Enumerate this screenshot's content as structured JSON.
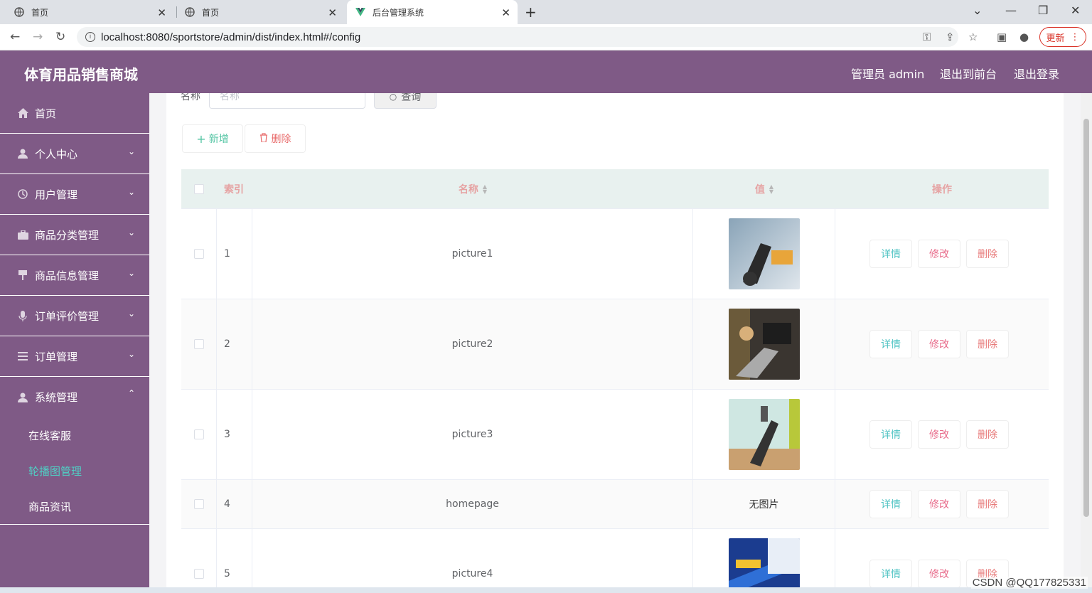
{
  "browser": {
    "tabs": [
      {
        "title": "首页",
        "favicon": "globe-icon"
      },
      {
        "title": "首页",
        "favicon": "globe-icon"
      },
      {
        "title": "后台管理系统",
        "favicon": "vue-logo-icon"
      }
    ],
    "url": "localhost:8080/sportstore/admin/dist/index.html#/config",
    "update_label": "更新"
  },
  "header": {
    "title": "体育用品销售商城",
    "admin_label": "管理员 admin",
    "to_front": "退出到前台",
    "logout": "退出登录"
  },
  "sidebar": {
    "items": [
      {
        "label": "首页",
        "icon": "home-icon",
        "expandable": false
      },
      {
        "label": "个人中心",
        "icon": "user-icon",
        "expandable": true
      },
      {
        "label": "用户管理",
        "icon": "clock-icon",
        "expandable": true
      },
      {
        "label": "商品分类管理",
        "icon": "briefcase-icon",
        "expandable": true
      },
      {
        "label": "商品信息管理",
        "icon": "pin-icon",
        "expandable": true
      },
      {
        "label": "订单评价管理",
        "icon": "microphone-icon",
        "expandable": true
      },
      {
        "label": "订单管理",
        "icon": "list-icon",
        "expandable": true
      },
      {
        "label": "系统管理",
        "icon": "user-icon",
        "expandable": true,
        "expanded": true
      }
    ],
    "subitems": [
      {
        "label": "在线客服",
        "active": false
      },
      {
        "label": "轮播图管理",
        "active": true
      },
      {
        "label": "商品资讯",
        "active": false
      }
    ]
  },
  "search": {
    "label": "名称",
    "placeholder": "名称",
    "button": "查询"
  },
  "toolbar": {
    "add": "新增",
    "delete": "删除"
  },
  "table": {
    "columns": [
      "索引",
      "名称",
      "值",
      "操作"
    ],
    "rows": [
      {
        "index": "1",
        "name": "picture1",
        "value_type": "image",
        "value_text": ""
      },
      {
        "index": "2",
        "name": "picture2",
        "value_type": "image",
        "value_text": ""
      },
      {
        "index": "3",
        "name": "picture3",
        "value_type": "image",
        "value_text": ""
      },
      {
        "index": "4",
        "name": "homepage",
        "value_type": "text",
        "value_text": "无图片"
      },
      {
        "index": "5",
        "name": "picture4",
        "value_type": "image",
        "value_text": ""
      }
    ],
    "actions": {
      "detail": "详情",
      "edit": "修改",
      "delete": "删除"
    }
  },
  "watermark": "CSDN @QQ177825331"
}
